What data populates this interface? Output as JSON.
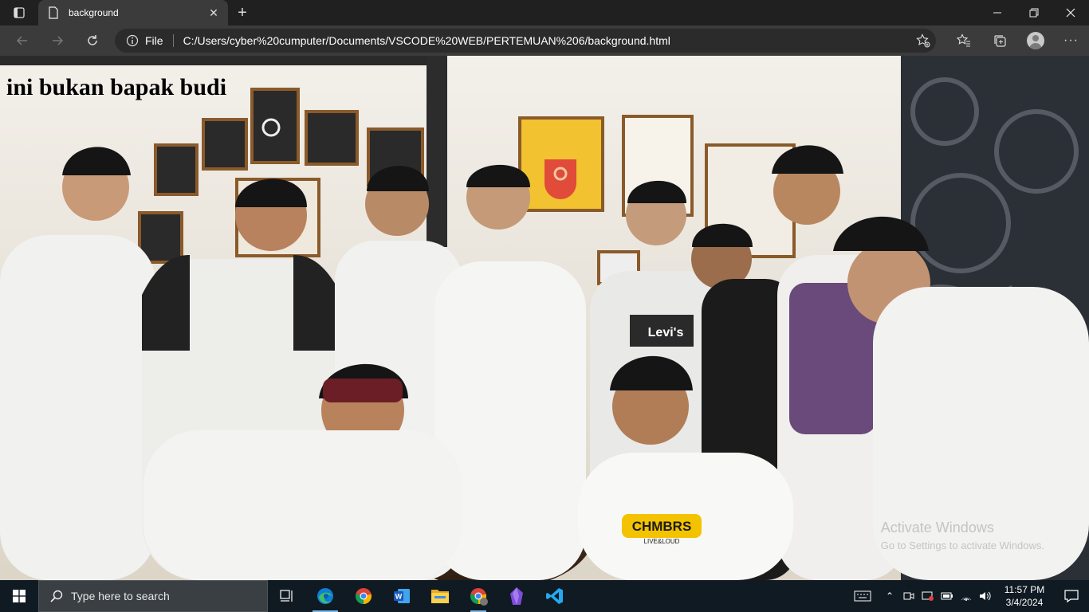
{
  "browser": {
    "tab_title": "background",
    "scheme_label": "File",
    "url": "C:/Users/cyber%20cumputer/Documents/VSCODE%20WEB/PERTEMUAN%206/background.html"
  },
  "page": {
    "heading": "ini bukan bapak budi",
    "photo_shirt_texts": [
      "Levi's",
      "CHMBRS",
      "LIVE&LOUD"
    ]
  },
  "watermark": {
    "line1": "Activate Windows",
    "line2": "Go to Settings to activate Windows."
  },
  "taskbar": {
    "search_placeholder": "Type here to search",
    "apps": [
      "task-view",
      "edge",
      "chrome",
      "word",
      "file-explorer",
      "chrome-profile",
      "obsidian",
      "vscode"
    ],
    "time": "11:57 PM",
    "date": "3/4/2024"
  },
  "colors": {
    "titlebar": "#202020",
    "toolbar": "#3b3b3b",
    "taskbar": "#101a22",
    "accent": "#76b9ed"
  }
}
